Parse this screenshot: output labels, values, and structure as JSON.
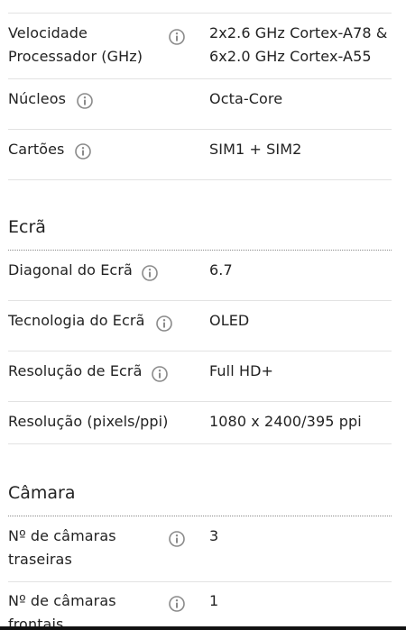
{
  "specs_top": {
    "processor_speed": {
      "label_line1": "Velocidade",
      "label_line2": "Processador (GHz)",
      "value_line1": "2x2.6 GHz Cortex-A78 &",
      "value_line2": "6x2.0 GHz Cortex-A55"
    },
    "cores": {
      "label": "Núcleos",
      "value": "Octa-Core"
    },
    "cards": {
      "label": "Cartões",
      "value": "SIM1 + SIM2"
    }
  },
  "screen": {
    "title": "Ecrã",
    "diagonal": {
      "label": "Diagonal do Ecrã",
      "value": "6.7"
    },
    "technology": {
      "label": "Tecnologia do Ecrã",
      "value": "OLED"
    },
    "resolution": {
      "label": "Resolução de Ecrã",
      "value": "Full HD+"
    },
    "resolution_ppi": {
      "label": "Resolução (pixels/ppi)",
      "value": "1080 x 2400/395 ppi"
    }
  },
  "camera": {
    "title": "Câmara",
    "rear_count": {
      "label_line1": "Nº de câmaras",
      "label_line2": "traseiras",
      "value": "3"
    },
    "front_count": {
      "label_line1": "Nº de câmaras",
      "label_line2": "frontais",
      "value": "1"
    }
  },
  "icons": {
    "info": "info-circle-icon"
  },
  "colors": {
    "text": "#222222",
    "icon": "#8a8a8a",
    "divider": "#e2e2e2"
  }
}
